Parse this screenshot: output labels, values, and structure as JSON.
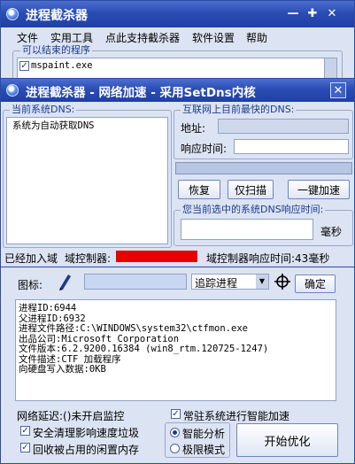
{
  "main_window": {
    "title": "进程截杀器",
    "controls": {
      "minimize": "—",
      "maximize": "✚",
      "close": "✕"
    },
    "menu": [
      "文件",
      "实用工具",
      "点此支持截杀器",
      "软件设置",
      "帮助"
    ],
    "ended_programs_group": "可以结束的程序",
    "program_item": "mspaint.exe",
    "icon_label": "图标:",
    "trace_dropdown": "追踪进程",
    "confirm_button": "确定",
    "process_info": [
      "进程ID:6944",
      "父进程ID:6932",
      "进程文件路径:C:\\WINDOWS\\system32\\ctfmon.exe",
      "出品公司:Microsoft Corporation",
      "文件版本:6.2.9200.16384 (win8_rtm.120725-1247)",
      "文件描述:CTF 加载程序",
      "向硬盘写入数据:0KB"
    ],
    "net_latency": "网络延迟:()未开启监控",
    "resident_label": "常驻系统进行智能加速",
    "safe_clean_label": "安全清理影响速度垃圾",
    "reclaim_memory_label": "回收被占用的闲置内存",
    "smart_analysis_label": "智能分析",
    "extreme_mode_label": "极限模式",
    "start_button": "开始优化"
  },
  "dns_window": {
    "title": "进程截杀器 - 网络加速 - 采用SetDns内核",
    "close": "✕",
    "current_dns_group": "当前系统DNS:",
    "current_dns_value": "系统为自动获取DNS",
    "best_dns_group": "互联网上目前最快的DNS:",
    "address_label": "地址:",
    "response_label": "响应时间:",
    "restore_button": "恢复",
    "scan_only_button": "仅扫描",
    "one_click_button": "一键加速",
    "selected_dns_group": "您当前选中的系统DNS响应时间:",
    "ms_unit": "毫秒",
    "status_left": "已经加入域",
    "domain_controller_label": "域控制器:",
    "domain_controller_value": "",
    "response_status": "域控制器响应时间:43毫秒"
  },
  "colors": {
    "title_blue": "#2a4db4",
    "panel": "#dce3f2",
    "redacted": "#e60000"
  }
}
